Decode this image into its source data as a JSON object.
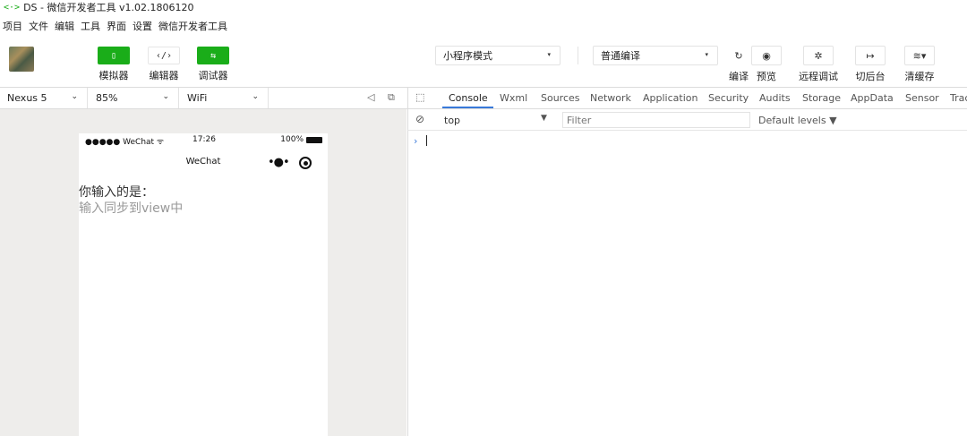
{
  "window": {
    "title": "DS - 微信开发者工具 v1.02.1806120",
    "app_icon": "<·>"
  },
  "menu": [
    "项目",
    "文件",
    "编辑",
    "工具",
    "界面",
    "设置",
    "微信开发者工具"
  ],
  "toolbar": {
    "simulator_label": "模拟器",
    "editor_label": "编辑器",
    "debugger_label": "调试器",
    "mode_select": "小程序模式",
    "compile_select": "普通编译",
    "compile_label": "编译",
    "preview_label": "预览",
    "remote_debug_label": "远程调试",
    "background_label": "切后台",
    "clear_cache_label": "清缓存",
    "simulator_glyph": "▯",
    "editor_glyph": "‹/›",
    "debugger_glyph": "⇆",
    "compile_glyph": "↻",
    "preview_glyph": "◉",
    "remote_glyph": "✲",
    "background_glyph": "↦",
    "cache_glyph": "≋▾",
    "caret": "▾"
  },
  "simulator_bar": {
    "device": "Nexus 5",
    "zoom": "85%",
    "network": "WiFi",
    "chevron": "⌄",
    "volume_glyph": "◁",
    "popout_glyph": "⧉"
  },
  "phone": {
    "carrier": "●●●●● WeChat ᯤ",
    "time": "17:26",
    "battery": "100%",
    "nav_title": "WeChat",
    "more_glyph": "•●•",
    "prompt": "你输入的是：",
    "input_placeholder": "输入同步到view中"
  },
  "devtools": {
    "inspect_glyph": "⬚",
    "tabs": [
      "Console",
      "Wxml",
      "Sources",
      "Network",
      "Application",
      "Security",
      "Audits",
      "Storage",
      "AppData",
      "Sensor",
      "Trac"
    ],
    "clear_glyph": "⊘",
    "context": "top",
    "context_caret": "▼",
    "filter_placeholder": "Filter",
    "levels": "Default levels ▼",
    "prompt_chevron": "›"
  },
  "colors": {
    "accent_green": "#1aad19",
    "accent_blue": "#3879d9"
  }
}
